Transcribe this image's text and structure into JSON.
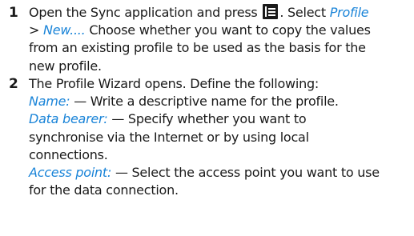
{
  "steps": [
    {
      "number": "1",
      "lines": [
        {
          "a": "Open the Sync application and press",
          "b": ". Select",
          "c": "Profile"
        },
        {
          "a": ">",
          "b": "New....",
          "c": "Choose whether you want to copy the values"
        },
        {
          "text": "from an existing profile to be used as the basis for the"
        },
        {
          "text": "new profile."
        }
      ]
    },
    {
      "number": "2",
      "intro": "The Profile Wizard opens. Define the following:",
      "fields": [
        {
          "label": "Name:",
          "lines": [
            "— Write a descriptive name for the profile."
          ]
        },
        {
          "label": "Data bearer:",
          "lines": [
            "— Specify whether you want to",
            "synchronise via the Internet or by using local",
            "connections."
          ]
        },
        {
          "label": "Access point:",
          "lines": [
            "— Select the access point you want to use",
            "for the data connection."
          ]
        }
      ]
    }
  ],
  "icons": {
    "menu_key": "menu-key-icon"
  }
}
